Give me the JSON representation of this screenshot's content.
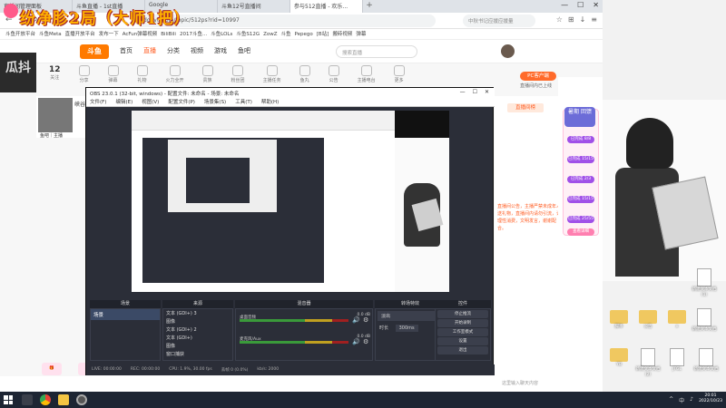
{
  "browser": {
    "tabs": [
      {
        "label": "直播间管理面板"
      },
      {
        "label": "斗鱼直播 - 1st直播"
      },
      {
        "label": "Google"
      },
      {
        "label": "斗鱼12号直播间"
      },
      {
        "label": "参与512直播 - 欢乐..."
      }
    ],
    "new_tab": "+",
    "url": "douyu.com/topic/512ps?rid=10997",
    "search_placeholder": "中秋书记应援应援量",
    "bookmarks": [
      "斗鱼开放平台",
      "斗鱼Meta",
      "直播开放平台",
      "发布一下",
      "AcFun弹幕视频",
      "BiliBili",
      "2017斗鱼...",
      "斗鱼LOLs",
      "斗鱼S12G",
      "ZowZ",
      "斗鱼",
      "Pepego",
      "[B站]",
      "搬砖视频",
      "弹幕"
    ],
    "window_controls": [
      "—",
      "☐",
      "✕"
    ]
  },
  "site": {
    "logo": "斗鱼",
    "nav": [
      "首页",
      "直播",
      "分类",
      "视频",
      "游戏",
      "鱼吧"
    ],
    "active_nav": "直播",
    "search_placeholder": "搜索直播",
    "pc_client": "PC客户端",
    "pc_client_sub": "直播间内已上线",
    "toolbar_num": "12",
    "toolbar_items": [
      "关注",
      "分享",
      "弹幕",
      "礼物",
      "火力全开",
      "贵族",
      "粉丝团",
      "主播任务",
      "鱼丸",
      "公告",
      "主播电台",
      "更多"
    ],
    "watermark_left": "瓜抖",
    "overlay_title": "纷净胗2局（大师1把）",
    "streamer_name": "鱼吧｜主播",
    "streamer_tag": "峡谷",
    "rp_tab": "直播间榜",
    "rp_text": "直播间公告，主播严禁未成年人送礼物，直播间内请勿引流，请理性消费，文明发言，谢谢配合。",
    "rp_input": "这里输入聊天内容",
    "promo_title": "暑期 回馈",
    "promo_badges": [
      "已完成 8/8",
      "已完成 15/15",
      "已完成 2/3",
      "已完成 15/15",
      "已完成 25/55"
    ],
    "promo_link": "查看详细"
  },
  "obs": {
    "title": "OBS 23.0.1 (32-bit, windows) - 配置文件: 未命名 - 场景: 未命名",
    "menu": [
      "文件(F)",
      "编辑(E)",
      "视图(V)",
      "配置文件(P)",
      "场景集(S)",
      "工具(T)",
      "帮助(H)"
    ],
    "docks": [
      "场景",
      "来源",
      "混音器",
      "转场特效",
      "控件"
    ],
    "scenes": [
      "场景"
    ],
    "sources": [
      "文本 (GDI+) 3",
      "图像",
      "文本 (GDI+) 2",
      "文本 (GDI+)",
      "图像",
      "窗口捕获"
    ],
    "mixer": [
      {
        "name": "桌面音频",
        "db": "0.0 dB"
      },
      {
        "name": "麦克风/Aux",
        "db": "0.0 dB"
      }
    ],
    "transition": "淡出",
    "duration_label": "时长",
    "duration": "300ms",
    "controls": [
      "停止推流",
      "开始录制",
      "工作室模式",
      "设置",
      "退出"
    ],
    "status": [
      "LIVE: 00:00:00",
      "REC: 00:00:00",
      "CPU: 1.9%, 30.00 fps",
      "丢帧 0 (0.0%)",
      "kb/s: 2000"
    ]
  },
  "desktop": {
    "files": [
      {
        "label": "新建文本文档 (1)",
        "type": "doc"
      },
      {
        "label": "新建文本文档",
        "type": "doc"
      },
      {
        "label": "脚本",
        "type": "folder"
      },
      {
        "label": "公告",
        "type": "folder"
      },
      {
        "label": "x",
        "type": "folder"
      },
      {
        "label": "YB",
        "type": "folder"
      },
      {
        "label": "新建文本文档(2)",
        "type": "doc"
      },
      {
        "label": "JTGL",
        "type": "doc"
      },
      {
        "label": "新建文本文档",
        "type": "doc"
      }
    ]
  },
  "taskbar": {
    "time": "20:01",
    "date": "2022/10/23",
    "sys_icons": [
      "^",
      "中",
      "♪"
    ]
  },
  "colors": {
    "accent": "#ff5d23",
    "obs_bg": "#2b2e38",
    "taskbar": "#1d2533"
  }
}
